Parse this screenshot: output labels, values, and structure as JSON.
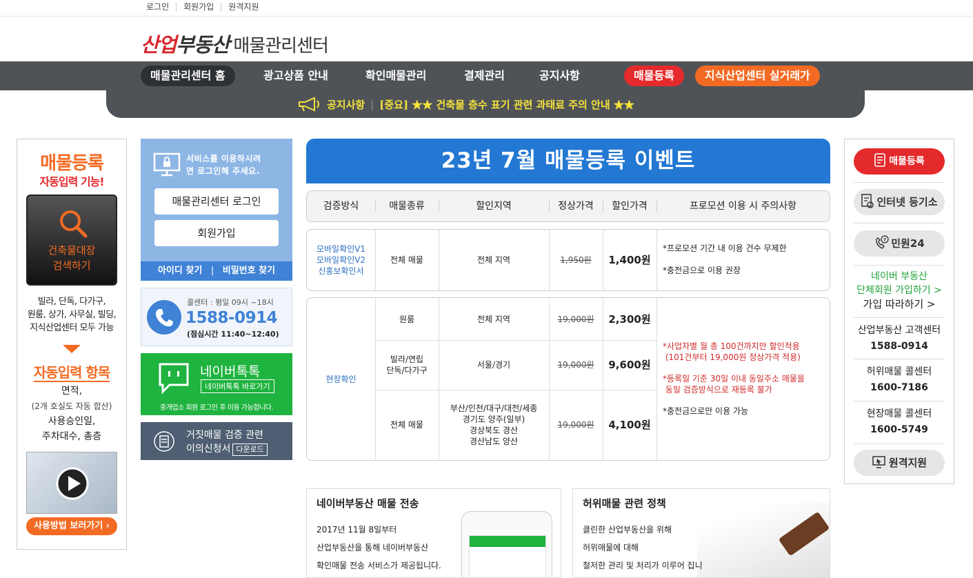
{
  "util": {
    "login": "로그인",
    "signup": "회원가입",
    "remote": "원격지원"
  },
  "logo": {
    "a": "산업",
    "b": "부동산",
    "c": "매물관리센터"
  },
  "nav": {
    "home": "매물관리센터 홈",
    "ad": "광고상품 안내",
    "confirm": "확인매물관리",
    "pay": "결제관리",
    "notice": "공지사항",
    "register": "매물등록",
    "ki": "지식산업센터 실거래가"
  },
  "notice_bar": {
    "label": "공지사항",
    "text": "[중요] ★★ 건축물 층수 표기 관련 과태료 주의 안내 ★★"
  },
  "left_banner": {
    "t1": "매물등록",
    "t2": "자동입력 기능!",
    "search_l1": "건축물대장",
    "search_l2": "검색하기",
    "desc_l1": "빌라, 단독, 다가구,",
    "desc_l2": "원룸, 상가, 사무실, 빌딩,",
    "desc_l3": "지식산업센터 모두 가능",
    "t3": "자동입력 항목",
    "i1": "면적,",
    "i1s": "(2개 호실도 자동 합산)",
    "i2": "사용승인일,",
    "i3": "주차대수, 총층",
    "btn": "사용방법 보러가기 ›"
  },
  "login_box": {
    "msg_l1": "서비스를 이용하시려",
    "msg_l2": "면 로그인해 주세요.",
    "login_btn": "매물관리센터 로그인",
    "signup_btn": "회원가입",
    "find_id": "아이디 찾기",
    "find_pw": "비밀번호 찾기"
  },
  "call": {
    "hours": "콜센터 : 평일 09시 ~18시",
    "number": "1588-0914",
    "lunch": "(점심시간 11:40~12:40)"
  },
  "talk": {
    "title": "네이버톡톡",
    "shortcut": "네이버톡톡 바로가기",
    "note": "중개업소 회원 로그인 후 이용 가능합니다."
  },
  "fake": {
    "l1": "거짓매물 검증 관련",
    "l2": "이의신청서",
    "download": "다운로드"
  },
  "event": {
    "title": "23년 7월 매물등록 이벤트",
    "headers": [
      "검증방식",
      "매물종류",
      "할인지역",
      "정상가격",
      "할인가격",
      "프로모션 이용 시 주의사항"
    ],
    "t1": {
      "methods": [
        "모바일확인V1",
        "모바일확인V2",
        "신홍보확인서"
      ],
      "type": "전체 매물",
      "region": "전체 지역",
      "orig": "1,950원",
      "price": "1,400원",
      "notes": [
        "*프로모션 기간 내 이용 건수 무제한",
        "*충전금으로 이용 권장"
      ]
    },
    "t2": {
      "method": "현장확인",
      "rows": [
        {
          "type": "원룸",
          "region": "전체 지역",
          "orig": "19,000원",
          "price": "2,300원"
        },
        {
          "type_l1": "빌라/연립",
          "type_l2": "단독/다가구",
          "region": "서울/경기",
          "orig": "19,000원",
          "price": "9,600원"
        },
        {
          "type": "전체 매물",
          "region_l1": "부산/인천/대구/대전/세종",
          "region_l2": "경기도 양주(일부)",
          "region_l3": "경상북도 경산",
          "region_l4": "경산남도 양산",
          "orig": "19,000원",
          "price": "4,100원"
        }
      ],
      "note1_l1": "*사업자별 월 총 100건까지만 할인적용",
      "note1_l2": "(101건부터 19,000원 정상가격 적용)",
      "note2_l1": "*등록일 기준 30일 이내 동일주소 매물을",
      "note2_l2": "동일 검증방식으로 재등록 불가",
      "note3": "*충전금으로만 이용 가능"
    }
  },
  "right": {
    "register": "매물등록",
    "registry": "인터넷 등기소",
    "minwon": "민원24",
    "naver_l1": "네이버 부동산",
    "naver_l2": "단체회원 가입하기 >",
    "naver_l3": "가입 따라하기 >",
    "cs_label": "산업부동산 고객센터",
    "cs_num": "1588-0914",
    "fake_label": "허위매물 콜센터",
    "fake_num": "1600-7186",
    "site_label": "현장매물 콜센터",
    "site_num": "1600-5749",
    "remote": "원격지원"
  },
  "bottom": {
    "naver": {
      "title": "네이버부동산 매물 전송",
      "p1": "2017년 11월 8일부터",
      "p2": "산업부동산을 통해 네이버부동산",
      "p3": "확인매물 전송 서비스가 제공됩니다."
    },
    "policy": {
      "title": "허위매물 관련 정책",
      "p1": "클린한 산업부동산을 위해",
      "p2": "허위매물에 대해",
      "p3": "철저한 관리 및 처리가 이루어 집니"
    }
  }
}
